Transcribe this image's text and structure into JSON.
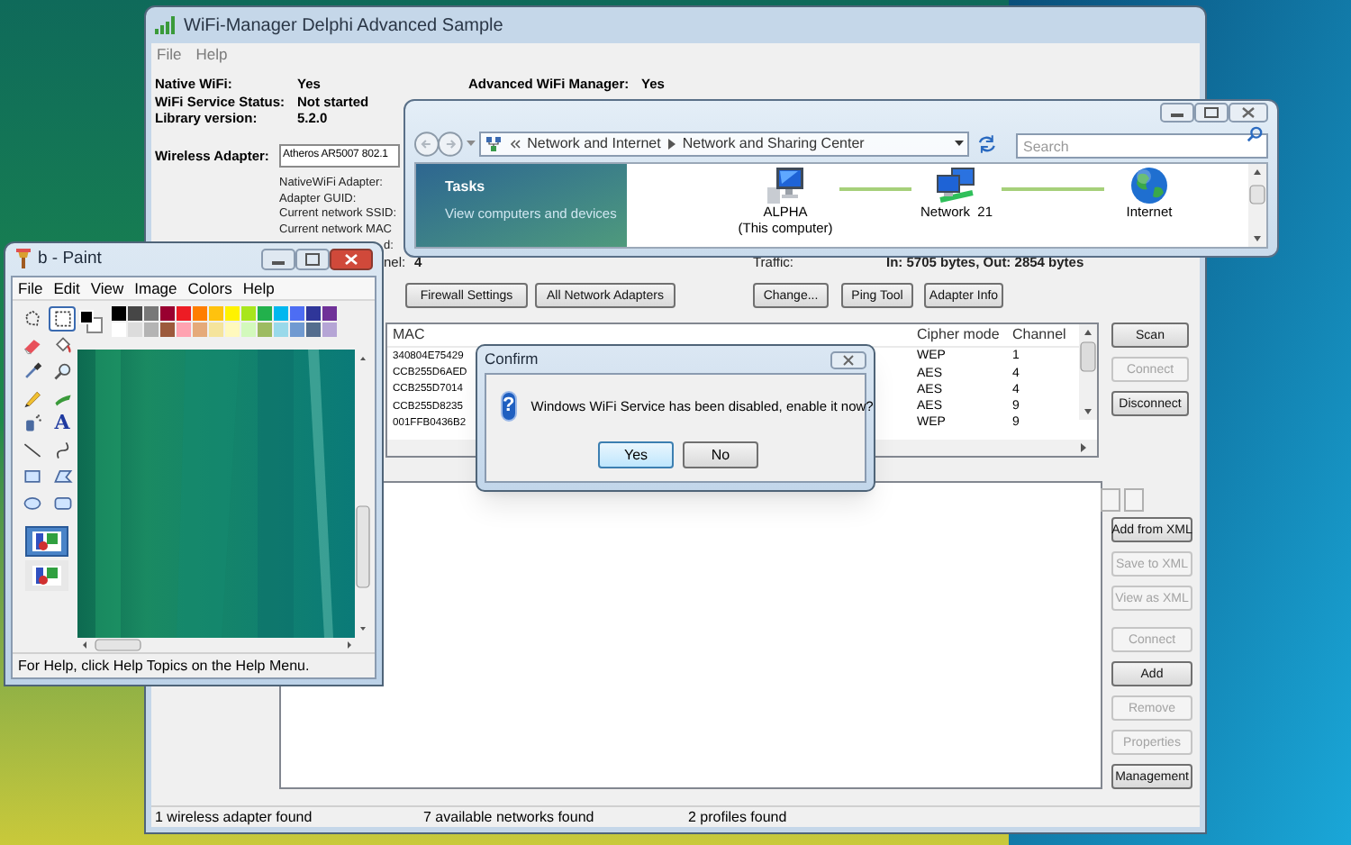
{
  "main_window": {
    "title": "WiFi-Manager Delphi Advanced Sample",
    "menu": [
      "File",
      "Help"
    ],
    "info": [
      {
        "label": "Native WiFi:",
        "value": "Yes"
      },
      {
        "label": "WiFi Service Status:",
        "value": "Not started"
      },
      {
        "label": "Library version:",
        "value": "5.2.0"
      }
    ],
    "advanced": {
      "label": "Advanced WiFi Manager:",
      "value": "Yes"
    },
    "adapter": {
      "label": "Wireless Adapter:",
      "value": "Atheros AR5007 802.1"
    },
    "details": [
      "NativeWiFi Adapter:",
      "Adapter GUID:",
      "Current network SSID:",
      "Current network MAC",
      "d:"
    ],
    "channel": {
      "label": "nel:",
      "value": "4"
    },
    "traffic": {
      "label": "Traffic:",
      "value": "In: 5705 bytes, Out: 2854 bytes"
    },
    "buttons_left": [
      "Firewall Settings",
      "All Network Adapters"
    ],
    "buttons_right": [
      "Change...",
      "Ping Tool",
      "Adapter Info"
    ],
    "networks_table": {
      "columns": [
        "MAC",
        "Cipher mode",
        "Channel"
      ],
      "rows": [
        [
          "340804E75429",
          "WEP",
          "1"
        ],
        [
          "CCB255D6AED",
          "AES",
          "4"
        ],
        [
          "CCB255D7014",
          "AES",
          "4"
        ],
        [
          "CCB255D8235",
          "AES",
          "9"
        ],
        [
          "001FFB0436B2",
          "WEP",
          "9"
        ]
      ]
    },
    "network_buttons": [
      {
        "label": "Scan",
        "disabled": false
      },
      {
        "label": "Connect",
        "disabled": true
      },
      {
        "label": "Disconnect",
        "disabled": false
      }
    ],
    "xml_buttons": [
      {
        "label": "Add from XML",
        "disabled": false
      },
      {
        "label": "Save to XML",
        "disabled": true
      },
      {
        "label": "View as XML",
        "disabled": true
      }
    ],
    "profile_buttons": [
      {
        "label": "Connect",
        "disabled": true
      },
      {
        "label": "Add",
        "disabled": false
      },
      {
        "label": "Remove",
        "disabled": true
      },
      {
        "label": "Properties",
        "disabled": true
      },
      {
        "label": "Management",
        "disabled": false
      }
    ],
    "status_bar": [
      "1 wireless adapter found",
      "7 available networks found",
      "2 profiles found"
    ]
  },
  "explorer_window": {
    "breadcrumb": [
      "Network and Internet",
      "Network and Sharing Center"
    ],
    "search": {
      "placeholder": "Search"
    },
    "tasks": {
      "title": "Tasks",
      "link": "View computers and devices"
    },
    "map": [
      {
        "kind": "computer",
        "label": "ALPHA",
        "sublabel": "(This computer)"
      },
      {
        "kind": "network",
        "label": "Network  21"
      },
      {
        "kind": "internet",
        "label": "Internet"
      }
    ]
  },
  "paint_window": {
    "title": "b - Paint",
    "menu": [
      "File",
      "Edit",
      "View",
      "Image",
      "Colors",
      "Help"
    ],
    "tools": [
      {
        "kind": "free-select",
        "selected": false
      },
      {
        "kind": "select",
        "selected": true
      },
      {
        "kind": "eraser",
        "selected": false
      },
      {
        "kind": "fill",
        "selected": false
      },
      {
        "kind": "picker",
        "selected": false
      },
      {
        "kind": "magnifier",
        "selected": false
      },
      {
        "kind": "pencil",
        "selected": false
      },
      {
        "kind": "brush",
        "selected": false
      },
      {
        "kind": "airbrush",
        "selected": false
      },
      {
        "kind": "text",
        "glyph": "A",
        "selected": false
      },
      {
        "kind": "line",
        "selected": false
      },
      {
        "kind": "curve",
        "selected": false
      },
      {
        "kind": "rectangle",
        "selected": false
      },
      {
        "kind": "polygon",
        "selected": false
      },
      {
        "kind": "ellipse",
        "selected": false
      },
      {
        "kind": "rounded-rectangle",
        "selected": false
      }
    ],
    "options": [
      {
        "selected": true
      },
      {
        "selected": false
      }
    ],
    "foreground": {
      "color": "#000000"
    },
    "background": {
      "color": "#ffffff"
    },
    "palette": [
      {
        "color": "#000000"
      },
      {
        "color": "#464646"
      },
      {
        "color": "#787878"
      },
      {
        "color": "#990030"
      },
      {
        "color": "#ed1c24"
      },
      {
        "color": "#ff7e00"
      },
      {
        "color": "#ffc20e"
      },
      {
        "color": "#fff200"
      },
      {
        "color": "#a8e61d"
      },
      {
        "color": "#22b14c"
      },
      {
        "color": "#00b7ef"
      },
      {
        "color": "#4d6df3"
      },
      {
        "color": "#2f3699"
      },
      {
        "color": "#6f3198"
      },
      {
        "color": "#ffffff"
      },
      {
        "color": "#dcdcdc"
      },
      {
        "color": "#b4b4b4"
      },
      {
        "color": "#9c5a3c"
      },
      {
        "color": "#ffa3b1"
      },
      {
        "color": "#e5aa7a"
      },
      {
        "color": "#f5e49c"
      },
      {
        "color": "#fff9bd"
      },
      {
        "color": "#d3f9bc"
      },
      {
        "color": "#9dbb61"
      },
      {
        "color": "#99d9ea"
      },
      {
        "color": "#709ad1"
      },
      {
        "color": "#546d8e"
      },
      {
        "color": "#b5a5d5"
      }
    ],
    "status": "For Help, click Help Topics on the Help Menu."
  },
  "dialog": {
    "title": "Confirm",
    "icon_glyph": "?",
    "message": "Windows WiFi Service has been disabled, enable it now?",
    "buttons": [
      {
        "label": "Yes",
        "selected": true
      },
      {
        "label": "No",
        "selected": false
      }
    ]
  }
}
